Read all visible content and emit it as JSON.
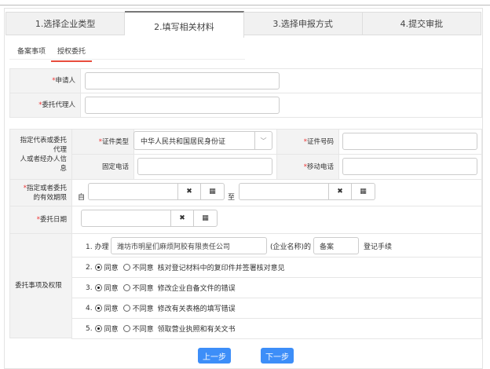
{
  "steps": [
    "1.选择企业类型",
    "2.填写相关材料",
    "3.选择申报方式",
    "4.提交审批"
  ],
  "subtabs": [
    "备案事项",
    "授权委托"
  ],
  "form": {
    "applicant_label": "申请人",
    "agent_label": "委托代理人",
    "group_label_lines": [
      "指定代表或委托",
      "代理",
      "人或者经办人信",
      "息"
    ],
    "id_type_label": "证件类型",
    "id_type_value": "中华人民共和国居民身份证",
    "id_no_label": "证件号码",
    "phone_label": "固定电话",
    "mobile_label": "移动电话",
    "period_label_lines": [
      "指定或者委托",
      "的有效期限"
    ],
    "from_label": "自",
    "to_label": "至",
    "date_label": "委托日期",
    "clear_icon": "✖",
    "calendar_icon": "▦",
    "authority_label": "委托事项及权限",
    "item1_prefix": "1. 办理",
    "company_name": "潍坊市明星们麻烦阿胶有限责任公司",
    "item1_mid": "(企业名称)的",
    "item1_type": "备案",
    "item1_suffix": "登记手续",
    "agree": "同意",
    "disagree": "不同意",
    "items": [
      {
        "num": "2.",
        "text": "核对登记材料中的复印件并签署核对意见"
      },
      {
        "num": "3.",
        "text": "修改企业自备文件的错误"
      },
      {
        "num": "4.",
        "text": "修改有关表格的填写错误"
      },
      {
        "num": "5.",
        "text": "领取营业执照和有关文书"
      }
    ]
  },
  "buttons": {
    "prev": "上一步",
    "next": "下一步"
  }
}
